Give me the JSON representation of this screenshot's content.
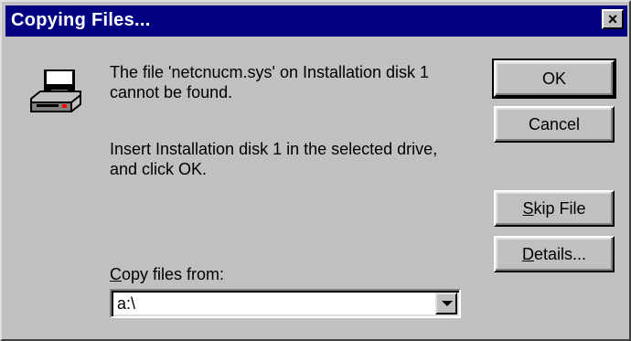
{
  "window": {
    "title": "Copying Files...",
    "close_glyph": "×"
  },
  "icon": {
    "name": "floppy-drive-icon"
  },
  "message": {
    "line1": "The file 'netcnucm.sys' on Installation disk 1",
    "line2": "cannot be found.",
    "line3": "Insert Installation disk 1 in the selected drive,",
    "line4": "and click OK."
  },
  "buttons": {
    "ok": "OK",
    "cancel": "Cancel",
    "skip_file_key": "S",
    "skip_file_rest": "kip File",
    "details_key": "D",
    "details_rest": "etails..."
  },
  "copy_from": {
    "label_key": "C",
    "label_rest": "opy files from:",
    "value": "a:\\"
  },
  "colors": {
    "titlebar": "#000080",
    "face": "#c0c0c0"
  }
}
